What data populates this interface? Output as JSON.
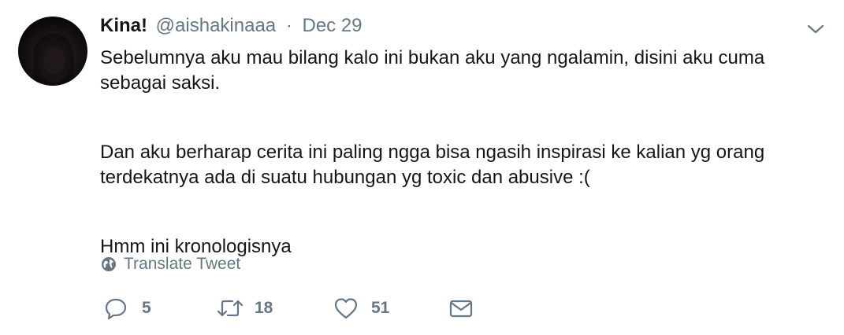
{
  "tweet": {
    "author": {
      "name": "Kina!",
      "handle": "@aishakinaaa",
      "separator": "·",
      "date": "Dec 29"
    },
    "paragraphs": [
      "Sebelumnya aku mau bilang kalo ini bukan aku yang ngalamin, disini aku cuma sebagai saksi.",
      "Dan aku berharap cerita ini paling ngga bisa ngasih inspirasi ke kalian yg orang terdekatnya ada di suatu hubungan yg toxic dan abusive :(",
      "Hmm ini kronologisnya"
    ],
    "translate_label": "Translate Tweet",
    "actions": {
      "reply_count": "5",
      "retweet_count": "18",
      "like_count": "51"
    }
  },
  "colors": {
    "text_primary": "#14171a",
    "text_secondary": "#657786"
  },
  "icons": [
    "chevron-down-icon",
    "globe-icon",
    "reply-icon",
    "retweet-icon",
    "heart-icon",
    "envelope-icon"
  ]
}
